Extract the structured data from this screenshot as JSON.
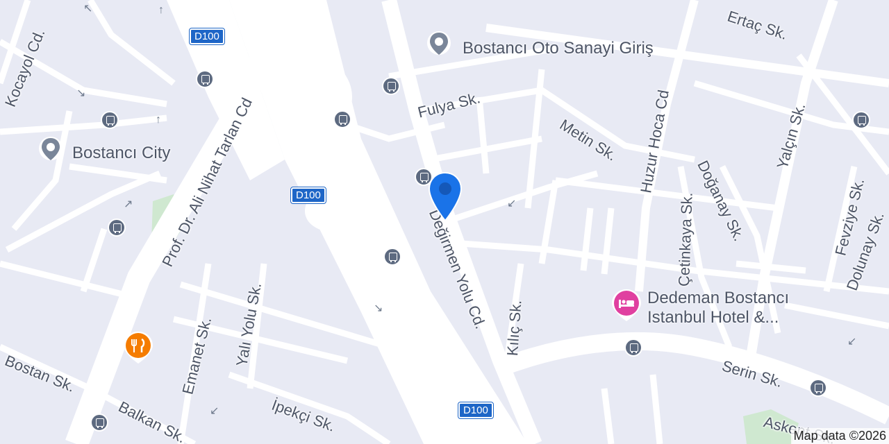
{
  "map": {
    "streets": [
      {
        "text": "Kocayol Cd."
      },
      {
        "text": "Prof. Dr. Ali Nihat Tarlan Cd"
      },
      {
        "text": "Fulya Sk."
      },
      {
        "text": "Metin Sk."
      },
      {
        "text": "Huzur Hoca Cd"
      },
      {
        "text": "Ertaç Sk."
      },
      {
        "text": "Yalçın Sk."
      },
      {
        "text": "Doğanay Sk."
      },
      {
        "text": "Çetinkaya Sk."
      },
      {
        "text": "Fevziye Sk."
      },
      {
        "text": "Dolunay Sk."
      },
      {
        "text": "Değirmen Yolu Cd."
      },
      {
        "text": "Kılıç Sk."
      },
      {
        "text": "Yalı Yolu Sk."
      },
      {
        "text": "Emanet Sk."
      },
      {
        "text": "Bostan Sk."
      },
      {
        "text": "Balkan Sk."
      },
      {
        "text": "İpekçi Sk."
      },
      {
        "text": "Serin Sk."
      },
      {
        "text": "Askent Sk."
      }
    ],
    "highway_shields": [
      "D100",
      "D100",
      "D100"
    ],
    "places": {
      "oto_sanayi": "Bostancı Oto Sanayi Giriş",
      "city": "Bostancı City",
      "hotel_line1": "Dedeman Bostancı",
      "hotel_line2": "Istanbul Hotel &..."
    },
    "icons": {
      "bus_stop": "bus-stop-icon",
      "restaurant": "restaurant-icon",
      "hotel": "hotel-icon",
      "location_marker": "location-pin-icon"
    },
    "colors": {
      "background": "#e8eaf4",
      "road": "#ffffff",
      "shield": "#1e66c7",
      "marker": "#1a73e8",
      "restaurant": "#f57c00",
      "hotel": "#e040a0",
      "park": "#cfe8d0"
    },
    "attribution": "Map data ©2026"
  }
}
